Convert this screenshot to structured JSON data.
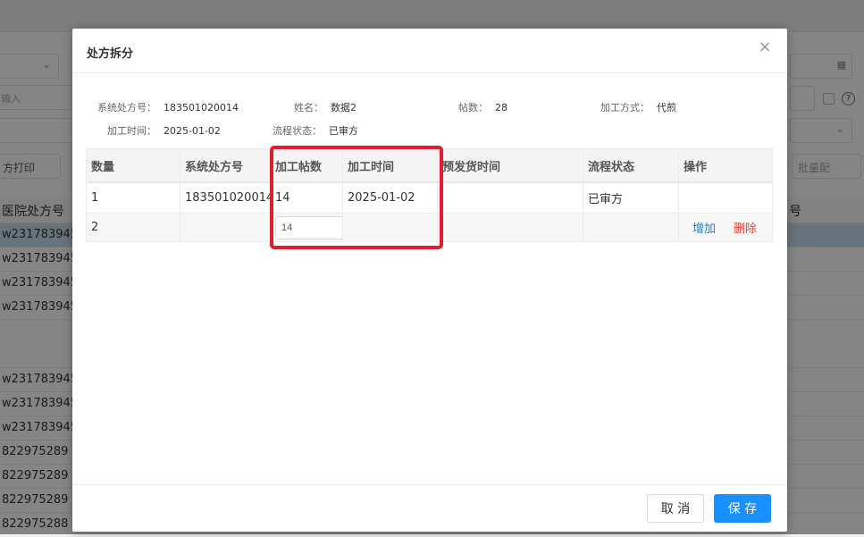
{
  "background": {
    "search_placeholder": "输入",
    "print_button": "方打印",
    "batch_button": "批量配",
    "column_hospital_no": "医院处方号",
    "column_no": "号",
    "rows": [
      "w231783945",
      "w231783945",
      "w231783945",
      "w231783945",
      "",
      "w231783945",
      "w231783945",
      "w231783945",
      "822975289",
      "822975289",
      "822975289",
      "822975288"
    ]
  },
  "modal": {
    "title": "处方拆分",
    "close_symbol": "×",
    "info": {
      "rx_no_label": "系统处方号：",
      "rx_no_value": "183501020014",
      "name_label": "姓名：",
      "name_value": "数据2",
      "doses_label": "帖数：",
      "doses_value": "28",
      "method_label": "加工方式：",
      "method_value": "代煎",
      "time_label": "加工时间：",
      "time_value": "2025-01-02",
      "status_label": "流程状态：",
      "status_value": "已审方"
    },
    "table": {
      "headers": [
        "数量",
        "系统处方号",
        "加工帖数",
        "加工时间",
        "预发货时间",
        "流程状态",
        "操作"
      ],
      "rows": [
        {
          "qty": "1",
          "rx_no": "183501020014",
          "doses": "14",
          "time": "2025-01-02",
          "ship_time": "",
          "status": "已审方"
        },
        {
          "qty": "2",
          "rx_no": "",
          "doses_input": "14",
          "time": "",
          "ship_time": "",
          "status": "",
          "add": "增加",
          "delete": "删除"
        }
      ]
    },
    "footer": {
      "cancel": "取 消",
      "save": "保 存"
    }
  }
}
